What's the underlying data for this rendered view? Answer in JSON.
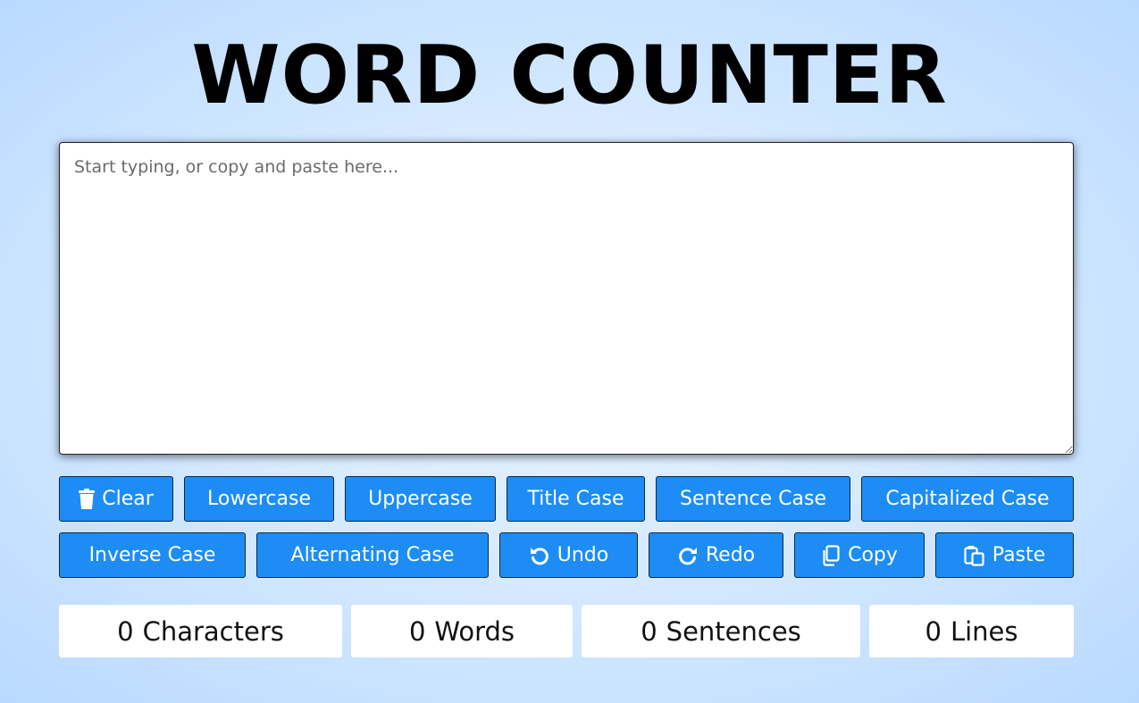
{
  "header": {
    "title": "WORD COUNTER"
  },
  "editor": {
    "placeholder": "Start typing, or copy and paste here..."
  },
  "toolbar": {
    "row1": [
      {
        "label": "Clear",
        "icon": "trash-icon"
      },
      {
        "label": "Lowercase"
      },
      {
        "label": "Uppercase"
      },
      {
        "label": "Title Case"
      },
      {
        "label": "Sentence Case"
      },
      {
        "label": "Capitalized Case"
      }
    ],
    "row2": [
      {
        "label": "Inverse Case"
      },
      {
        "label": "Alternating Case"
      },
      {
        "label": "Undo",
        "icon": "undo-icon"
      },
      {
        "label": "Redo",
        "icon": "redo-icon"
      },
      {
        "label": "Copy",
        "icon": "copy-icon"
      },
      {
        "label": "Paste",
        "icon": "paste-icon"
      }
    ]
  },
  "stats": [
    {
      "count": "0",
      "label": "Characters"
    },
    {
      "count": "0",
      "label": "Words"
    },
    {
      "count": "0",
      "label": "Sentences"
    },
    {
      "count": "0",
      "label": "Lines"
    }
  ],
  "colors": {
    "button_bg": "#1e8cf5",
    "button_text": "#ffffff",
    "title_text": "#000000"
  }
}
